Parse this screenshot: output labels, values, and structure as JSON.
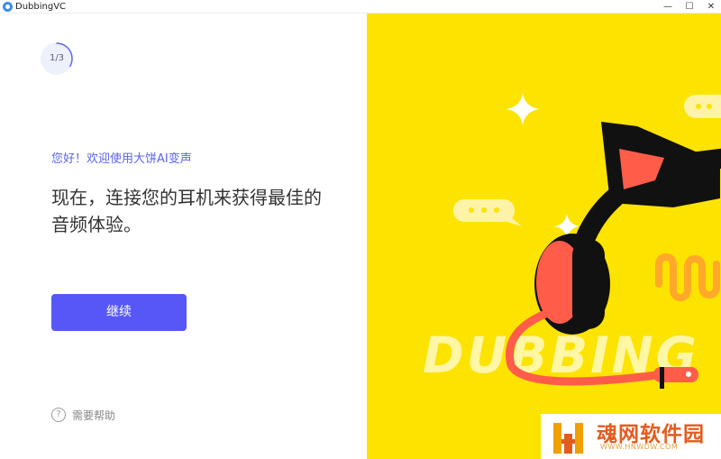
{
  "window": {
    "title": "DubbingVC",
    "minimize_glyph": "—",
    "maximize_glyph": "☐",
    "close_glyph": "✕"
  },
  "onboarding": {
    "step": "1/3",
    "step_progress": 0.3333,
    "greeting": "您好！欢迎使用大饼AI变声",
    "headline": "现在，连接您的耳机来获得最佳的音频体验。",
    "continue_label": "继续",
    "help_label": "需要帮助",
    "help_icon": "question-circle-icon"
  },
  "illustration": {
    "background_color": "#fde300",
    "brand_text": "DUBBING",
    "headphone_color": "#111111",
    "accent_color": "#ff5d4a",
    "wave_color": "#ffa82a",
    "icons": [
      "sparkle-icon",
      "speech-bubble-icon",
      "headphones-icon",
      "sound-wave-icon"
    ]
  },
  "watermark": {
    "text": "魂网软件园",
    "url": "WWW.HNWDW.COM"
  },
  "colors": {
    "accent": "#5757f7",
    "greeting": "#5b63f0",
    "headline": "#333333"
  }
}
